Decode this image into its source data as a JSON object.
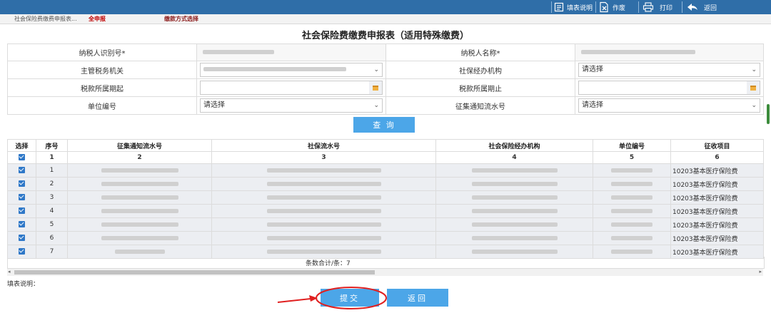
{
  "toolbar": {
    "help_label": "填表说明",
    "void_label": "作废",
    "print_label": "打印",
    "back_label": "返回"
  },
  "tabs": {
    "breadcrumb": "社会保险费缴费申报表...",
    "full_declare": "全申报",
    "payment_select": "缴款方式选择"
  },
  "page_title": "社会保险费缴费申报表（适用特殊缴费）",
  "form": {
    "taxpayer_id_label": "纳税人识别号*",
    "taxpayer_name_label": "纳税人名称*",
    "tax_authority_label": "主管税务机关",
    "social_agency_label": "社保经办机构",
    "social_agency_value": "请选择",
    "period_start_label": "税款所属期起",
    "period_end_label": "税款所属期止",
    "unit_no_label": "单位编号",
    "unit_no_value": "请选择",
    "notice_no_label": "征集通知流水号",
    "notice_no_value": "请选择"
  },
  "query_button": "查 询",
  "table": {
    "headers": [
      "选择",
      "序号",
      "征集通知流水号",
      "社保流水号",
      "社会保险经办机构",
      "单位编号",
      "征收项目"
    ],
    "index_row": [
      "1",
      "2",
      "3",
      "4",
      "5",
      "6"
    ],
    "rows": [
      {
        "seq": "1",
        "item": "10203基本医疗保险费"
      },
      {
        "seq": "2",
        "item": "10203基本医疗保险费"
      },
      {
        "seq": "3",
        "item": "10203基本医疗保险费"
      },
      {
        "seq": "4",
        "item": "10203基本医疗保险费"
      },
      {
        "seq": "5",
        "item": "10203基本医疗保险费"
      },
      {
        "seq": "6",
        "item": "10203基本医疗保险费"
      },
      {
        "seq": "7",
        "item": "10203基本医疗保险费"
      }
    ],
    "summary": "条数合计/条：7"
  },
  "notes_label": "填表说明：",
  "submit_label": "提交",
  "return_label": "返回",
  "colors": {
    "topbar": "#2f6ea8",
    "button": "#4ca6e8",
    "highlight": "#e02020"
  }
}
